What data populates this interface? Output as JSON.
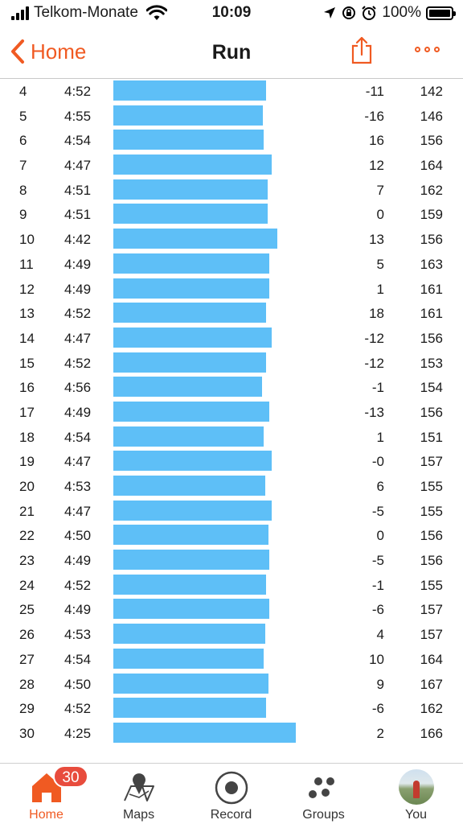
{
  "status_bar": {
    "carrier": "Telkom-Monate",
    "time": "10:09",
    "battery": "100%"
  },
  "nav": {
    "back_label": "Home",
    "title": "Run"
  },
  "splits": [
    {
      "km": "4",
      "pace": "4:52",
      "elev": "-11",
      "hr": "142",
      "pace_sec": 292
    },
    {
      "km": "5",
      "pace": "4:55",
      "elev": "-16",
      "hr": "146",
      "pace_sec": 295
    },
    {
      "km": "6",
      "pace": "4:54",
      "elev": "16",
      "hr": "156",
      "pace_sec": 294
    },
    {
      "km": "7",
      "pace": "4:47",
      "elev": "12",
      "hr": "164",
      "pace_sec": 287
    },
    {
      "km": "8",
      "pace": "4:51",
      "elev": "7",
      "hr": "162",
      "pace_sec": 291
    },
    {
      "km": "9",
      "pace": "4:51",
      "elev": "0",
      "hr": "159",
      "pace_sec": 291
    },
    {
      "km": "10",
      "pace": "4:42",
      "elev": "13",
      "hr": "156",
      "pace_sec": 282
    },
    {
      "km": "11",
      "pace": "4:49",
      "elev": "5",
      "hr": "163",
      "pace_sec": 289
    },
    {
      "km": "12",
      "pace": "4:49",
      "elev": "1",
      "hr": "161",
      "pace_sec": 289
    },
    {
      "km": "13",
      "pace": "4:52",
      "elev": "18",
      "hr": "161",
      "pace_sec": 292
    },
    {
      "km": "14",
      "pace": "4:47",
      "elev": "-12",
      "hr": "156",
      "pace_sec": 287
    },
    {
      "km": "15",
      "pace": "4:52",
      "elev": "-12",
      "hr": "153",
      "pace_sec": 292
    },
    {
      "km": "16",
      "pace": "4:56",
      "elev": "-1",
      "hr": "154",
      "pace_sec": 296
    },
    {
      "km": "17",
      "pace": "4:49",
      "elev": "-13",
      "hr": "156",
      "pace_sec": 289
    },
    {
      "km": "18",
      "pace": "4:54",
      "elev": "1",
      "hr": "151",
      "pace_sec": 294
    },
    {
      "km": "19",
      "pace": "4:47",
      "elev": "-0",
      "hr": "157",
      "pace_sec": 287
    },
    {
      "km": "20",
      "pace": "4:53",
      "elev": "6",
      "hr": "155",
      "pace_sec": 293
    },
    {
      "km": "21",
      "pace": "4:47",
      "elev": "-5",
      "hr": "155",
      "pace_sec": 287
    },
    {
      "km": "22",
      "pace": "4:50",
      "elev": "0",
      "hr": "156",
      "pace_sec": 290
    },
    {
      "km": "23",
      "pace": "4:49",
      "elev": "-5",
      "hr": "156",
      "pace_sec": 289
    },
    {
      "km": "24",
      "pace": "4:52",
      "elev": "-1",
      "hr": "155",
      "pace_sec": 292
    },
    {
      "km": "25",
      "pace": "4:49",
      "elev": "-6",
      "hr": "157",
      "pace_sec": 289
    },
    {
      "km": "26",
      "pace": "4:53",
      "elev": "4",
      "hr": "157",
      "pace_sec": 293
    },
    {
      "km": "27",
      "pace": "4:54",
      "elev": "10",
      "hr": "164",
      "pace_sec": 294
    },
    {
      "km": "28",
      "pace": "4:50",
      "elev": "9",
      "hr": "167",
      "pace_sec": 290
    },
    {
      "km": "29",
      "pace": "4:52",
      "elev": "-6",
      "hr": "162",
      "pace_sec": 292
    },
    {
      "km": "30",
      "pace": "4:25",
      "elev": "2",
      "hr": "166",
      "pace_sec": 265
    }
  ],
  "tabs": {
    "home": {
      "label": "Home",
      "badge": "30"
    },
    "maps": {
      "label": "Maps"
    },
    "record": {
      "label": "Record"
    },
    "groups": {
      "label": "Groups"
    },
    "you": {
      "label": "You"
    }
  },
  "colors": {
    "accent": "#f05a22",
    "bar": "#5ebff7",
    "badge": "#e84c3d"
  }
}
